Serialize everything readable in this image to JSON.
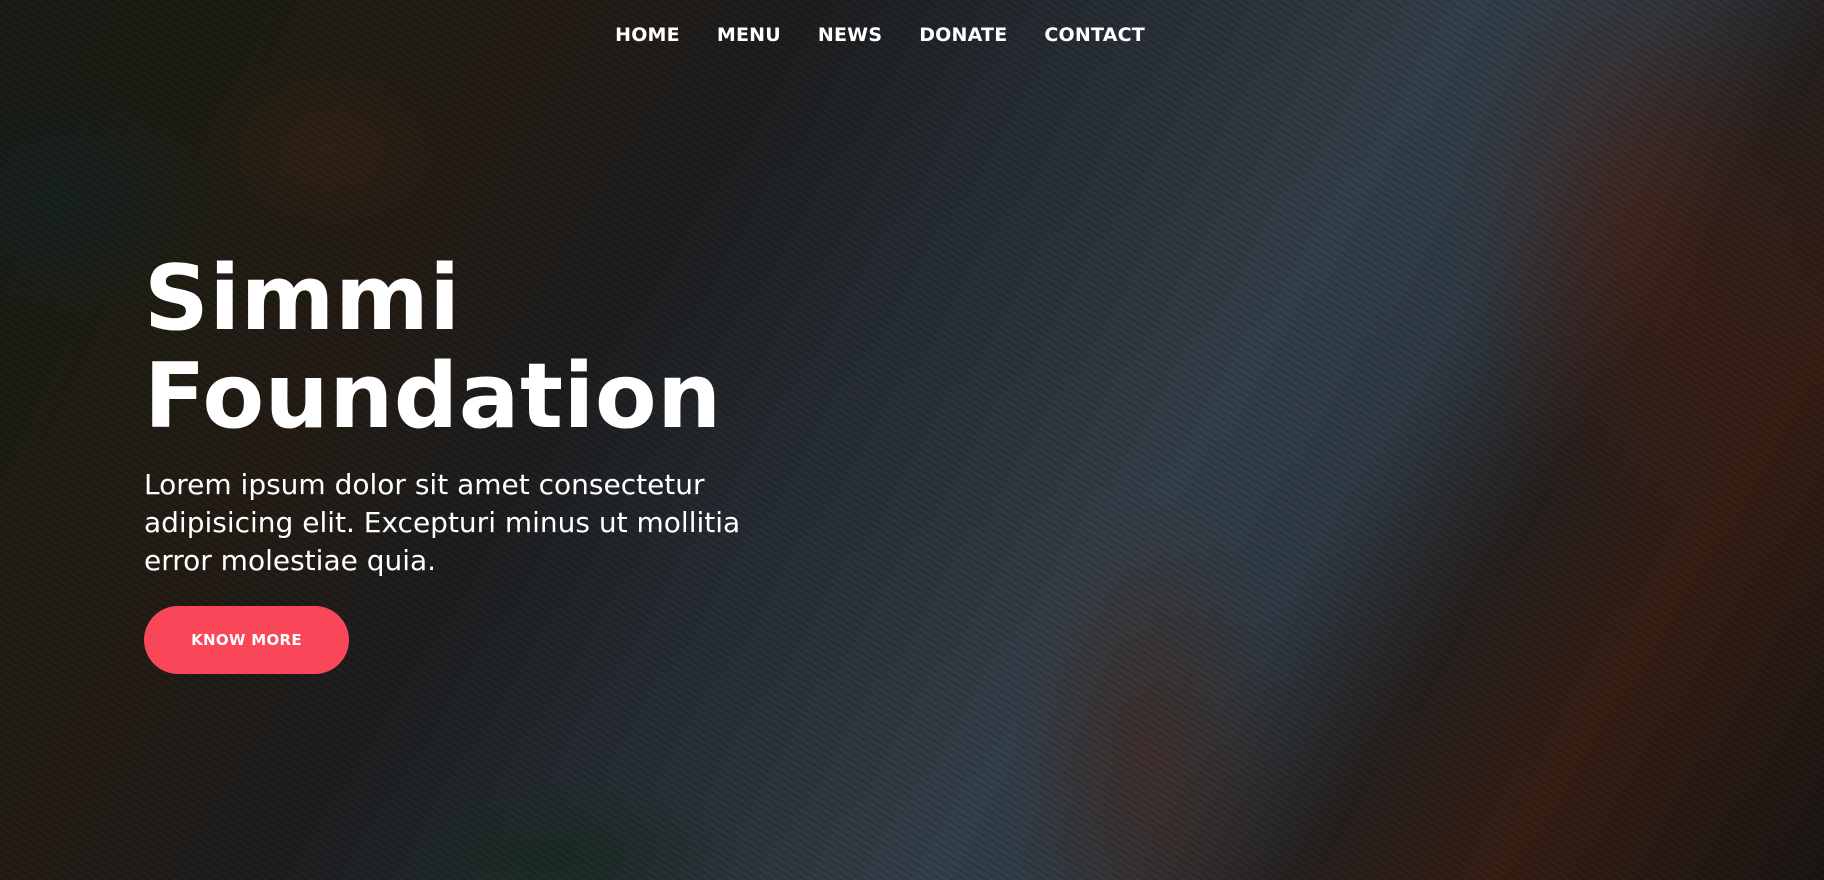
{
  "nav": {
    "items": [
      {
        "label": "HOME"
      },
      {
        "label": "MENU"
      },
      {
        "label": "NEWS"
      },
      {
        "label": "DONATE"
      },
      {
        "label": "CONTACT"
      }
    ]
  },
  "hero": {
    "title_line1": "Simmi",
    "title_line2": "Foundation",
    "description": "Lorem ipsum dolor sit amet consectetur adipisicing elit. Excepturi minus ut mollitia error molestiae quia.",
    "cta_label": "KNOW MORE"
  },
  "colors": {
    "accent": "#fa4659",
    "text": "#ffffff"
  }
}
